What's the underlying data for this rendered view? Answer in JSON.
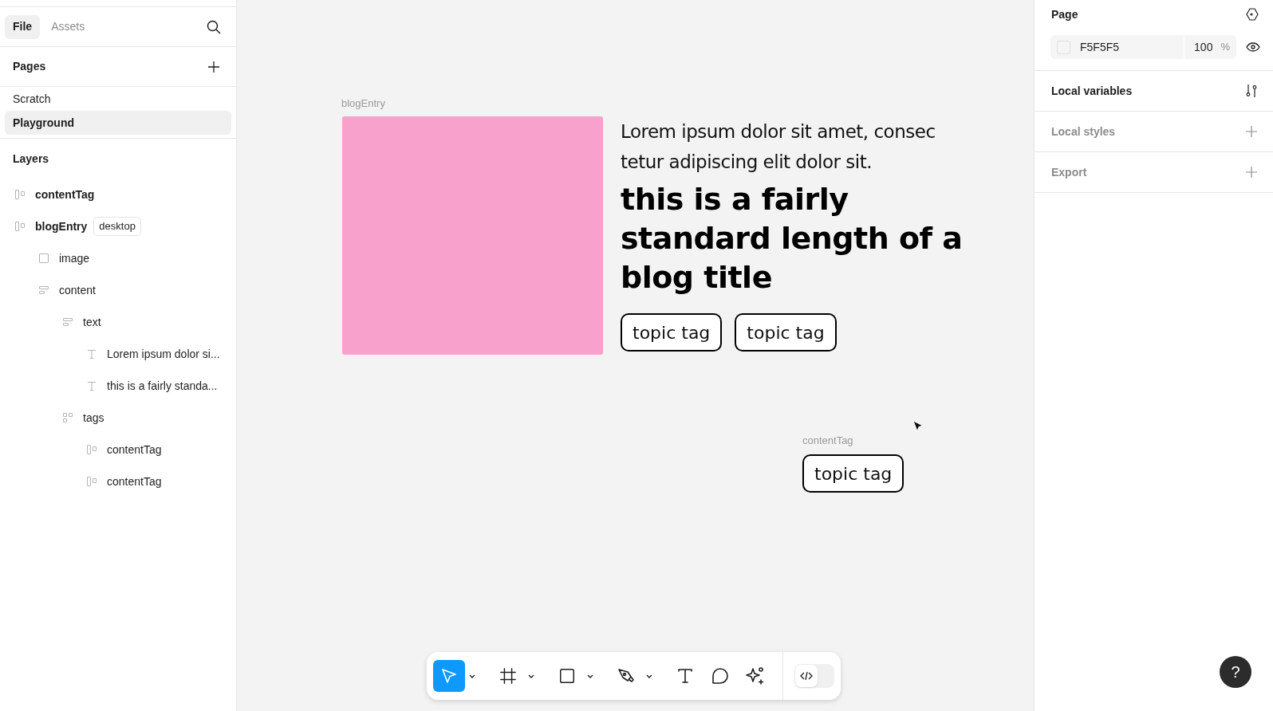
{
  "sidebar": {
    "tabs": [
      {
        "label": "File",
        "selected": true
      },
      {
        "label": "Assets",
        "selected": false
      }
    ],
    "pages": {
      "title": "Pages",
      "items": [
        {
          "label": "Scratch",
          "selected": false
        },
        {
          "label": "Playground",
          "selected": true
        }
      ]
    },
    "layers": {
      "title": "Layers",
      "items": [
        {
          "kind": "component",
          "name": "contentTag"
        },
        {
          "kind": "component",
          "name": "blogEntry",
          "badge": "desktop",
          "children": [
            {
              "kind": "rectangle",
              "name": "image"
            },
            {
              "kind": "stack",
              "name": "content",
              "children": [
                {
                  "kind": "stack",
                  "name": "text",
                  "children": [
                    {
                      "kind": "text",
                      "name": "Lorem ipsum dolor si..."
                    },
                    {
                      "kind": "text",
                      "name": "this is a fairly standa..."
                    }
                  ]
                },
                {
                  "kind": "grid",
                  "name": "tags",
                  "children": [
                    {
                      "kind": "component",
                      "name": "contentTag"
                    },
                    {
                      "kind": "component",
                      "name": "contentTag"
                    }
                  ]
                }
              ]
            }
          ]
        }
      ]
    }
  },
  "canvas": {
    "blog_entry": {
      "label": "blogEntry",
      "intro": "Lorem ipsum dolor sit amet, consec tetur adipiscing elit dolor sit.",
      "title": "this is a fairly standard length of a blog title",
      "tags": [
        "topic tag",
        "topic tag"
      ]
    },
    "content_tag": {
      "label": "contentTag",
      "tag": "topic tag"
    }
  },
  "toolbar": {
    "tools": [
      {
        "kind": "move",
        "selected": true,
        "menu": true
      },
      {
        "kind": "frame",
        "selected": false,
        "menu": true
      },
      {
        "kind": "rectangle",
        "selected": false,
        "menu": true
      },
      {
        "kind": "pen",
        "selected": false,
        "menu": true
      },
      {
        "kind": "text",
        "selected": false,
        "menu": false
      },
      {
        "kind": "comment",
        "selected": false,
        "menu": false
      },
      {
        "kind": "ai",
        "selected": false,
        "menu": false
      }
    ],
    "dev_mode": {
      "on": false
    }
  },
  "right_panel": {
    "page": {
      "title": "Page",
      "color": "#f5f5f5",
      "hex": "F5F5F5",
      "opacity": "100",
      "unit": "%"
    },
    "sections": [
      {
        "label": "Local variables",
        "kind": "variables",
        "active": true
      },
      {
        "label": "Local styles",
        "kind": "add",
        "active": false
      },
      {
        "label": "Export",
        "kind": "add",
        "active": false
      }
    ]
  },
  "help": {
    "label": "?"
  }
}
